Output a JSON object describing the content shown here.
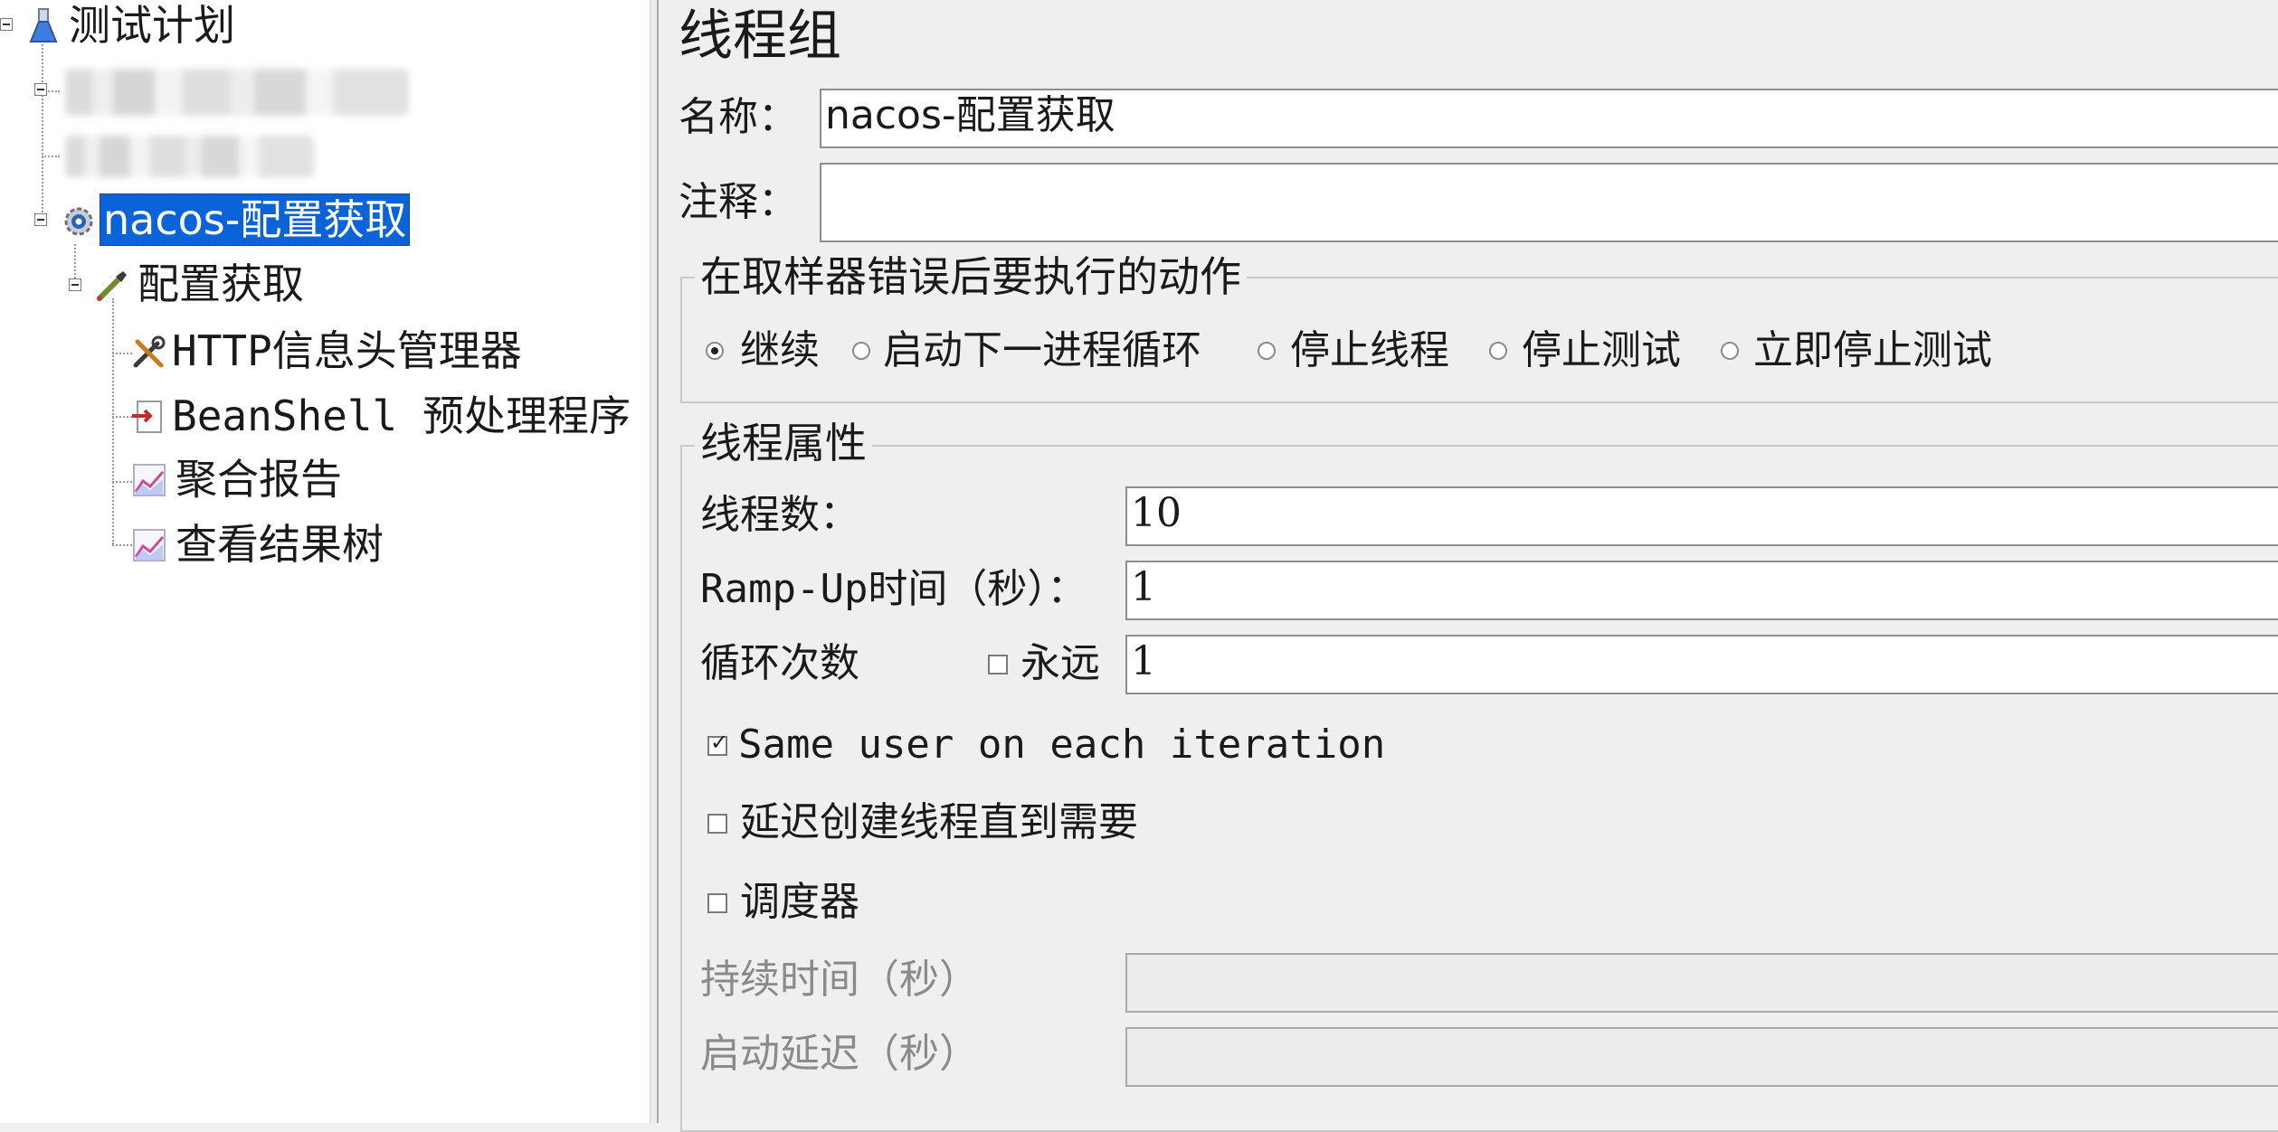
{
  "tree": {
    "root_label": "测试计划",
    "thread_group_label": "nacos-配置获取",
    "sampler_label": "配置获取",
    "children": [
      {
        "label": "HTTP信息头管理器",
        "icon": "wrench-icon"
      },
      {
        "label": "BeanShell 预处理程序",
        "icon": "beanshell-icon"
      },
      {
        "label": "聚合报告",
        "icon": "graph-icon"
      },
      {
        "label": "查看结果树",
        "icon": "graph-icon"
      }
    ],
    "selected_color": "#0a63d9"
  },
  "editor": {
    "title": "线程组",
    "name_label": "名称：",
    "name_value": "nacos-配置获取",
    "comment_label": "注释：",
    "comment_value": "",
    "error_action": {
      "legend": "在取样器错误后要执行的动作",
      "options": [
        "继续",
        "启动下一进程循环",
        "停止线程",
        "停止测试",
        "立即停止测试"
      ],
      "selected": "继续"
    },
    "thread_props": {
      "legend": "线程属性",
      "threads_label": "线程数：",
      "threads_value": "10",
      "rampup_label": "Ramp-Up时间（秒）：",
      "rampup_value": "1",
      "loop_label": "循环次数",
      "forever_label": "永远",
      "forever_checked": false,
      "loop_value": "1",
      "same_user_label": "Same user on each iteration",
      "same_user_checked": true,
      "delay_label": "延迟创建线程直到需要",
      "delay_checked": false,
      "scheduler_label": "调度器",
      "scheduler_checked": false,
      "duration_label": "持续时间（秒）",
      "duration_value": "",
      "startup_delay_label": "启动延迟（秒）",
      "startup_delay_value": ""
    }
  }
}
